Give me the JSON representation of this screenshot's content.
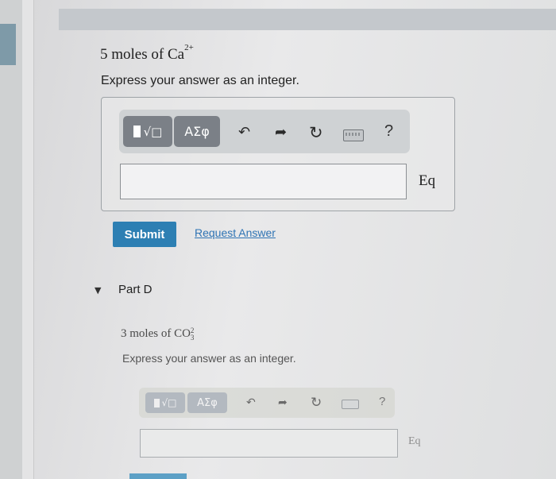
{
  "question": {
    "prefix": "5 moles of Ca",
    "superscript": "2+"
  },
  "instruction": "Express your answer as an integer.",
  "toolbar": {
    "templates_label": "√□",
    "symbols_label": "ΑΣφ",
    "help_label": "?"
  },
  "answer": {
    "value": "",
    "unit_label": "Eq"
  },
  "actions": {
    "submit_label": "Submit",
    "request_label": "Request Answer"
  },
  "part_d": {
    "title": "Part D",
    "question": {
      "prefix": "3 moles of CO",
      "superscript": "2",
      "subscript": "3"
    },
    "instruction": "Express your answer as an integer.",
    "toolbar": {
      "templates_label": "√□",
      "symbols_label": "ΑΣφ",
      "help_label": "?"
    },
    "answer": {
      "value": "",
      "unit_label": "Eq"
    }
  },
  "colors": {
    "submit": "#2d7fb3",
    "link": "#2f74b4",
    "toolbar_button": "#7b8087"
  },
  "icons": [
    "undo-icon",
    "redo-icon",
    "reset-icon",
    "keyboard-icon",
    "help-icon",
    "caret-down-icon"
  ]
}
